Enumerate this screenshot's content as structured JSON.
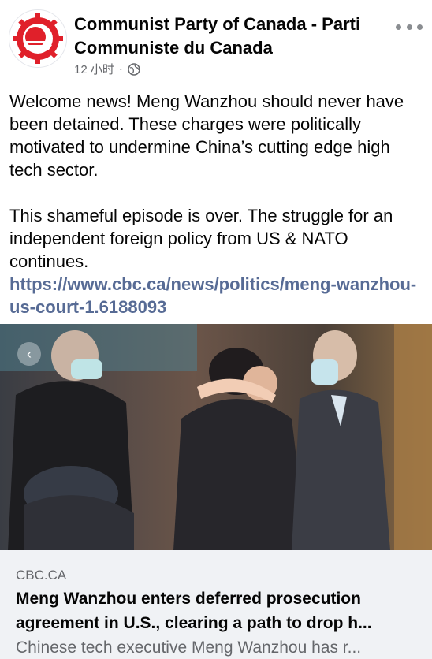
{
  "post": {
    "page_name": "Communist Party of Canada - Parti Communiste du Canada",
    "time": "12 小时",
    "separator": "·",
    "privacy_icon": "globe-icon",
    "text_p1": "Welcome news! Meng Wanzhou should never have been detained. These charges were politically motivated to undermine China’s cutting edge high tech sector.",
    "text_p2": "This shameful episode is over. The struggle for an independent foreign policy from US & NATO continues.",
    "link": "https://www.cbc.ca/news/politics/meng-wanzhou-us-court-1.6188093"
  },
  "link_card": {
    "source": "CBC.CA",
    "headline": "Meng Wanzhou enters deferred prosecution agreement in U.S., clearing a path to drop h...",
    "snippet": "Chinese tech executive Meng Wanzhou has r..."
  },
  "colors": {
    "link": "#576b95",
    "logo_red": "#e0202a",
    "muted": "#65676b",
    "card_bg": "#f0f2f5"
  }
}
